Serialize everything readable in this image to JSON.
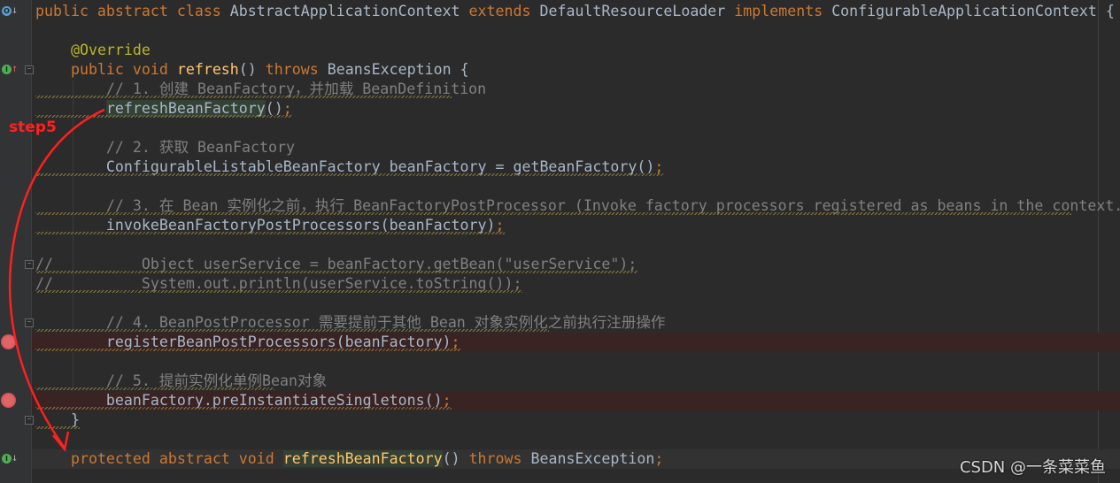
{
  "editor": {
    "language": "java",
    "colors": {
      "background": "#2b2b2b",
      "keyword": "#cc7832",
      "annotation": "#bbb529",
      "method": "#ffc66d",
      "text": "#a9b7c6",
      "comment": "#808080",
      "breakpoint": "#e06666",
      "annotation_arrow": "#ff2020"
    },
    "lines": [
      {
        "tokens": [
          [
            "kw",
            "public abstract class "
          ],
          [
            "id",
            "AbstractApplicationContext "
          ],
          [
            "kw",
            "extends "
          ],
          [
            "id",
            "DefaultResourceLoader "
          ],
          [
            "kw",
            "implements "
          ],
          [
            "id",
            "ConfigurableApplicationContext {"
          ]
        ]
      },
      {
        "tokens": []
      },
      {
        "tokens": [
          [
            "id",
            "    "
          ],
          [
            "ann",
            "@Override"
          ]
        ]
      },
      {
        "tokens": [
          [
            "id",
            "    "
          ],
          [
            "kw",
            "public void "
          ],
          [
            "fn",
            "refresh"
          ],
          [
            "id",
            "() "
          ],
          [
            "kw",
            "throws "
          ],
          [
            "id",
            "BeansException {"
          ]
        ]
      },
      {
        "tokens": [
          [
            "cm",
            "        // 1. 创建 BeanFactory，并加载 BeanDefinition"
          ]
        ],
        "squiggle": true
      },
      {
        "tokens": [
          [
            "id",
            "        "
          ],
          [
            "hl2",
            "refreshBeanFactory"
          ],
          [
            "id",
            "()"
          ],
          [
            "semi",
            ";"
          ]
        ],
        "squiggle": true
      },
      {
        "tokens": []
      },
      {
        "tokens": [
          [
            "cm",
            "        // 2. 获取 BeanFactory"
          ]
        ]
      },
      {
        "tokens": [
          [
            "id",
            "        ConfigurableListableBeanFactory beanFactory = getBeanFactory()"
          ],
          [
            "semi",
            ";"
          ]
        ],
        "squiggle": true
      },
      {
        "tokens": []
      },
      {
        "tokens": [
          [
            "cm",
            "        // 3. 在 Bean 实例化之前，执行 BeanFactoryPostProcessor (Invoke factory processors registered as beans in the context."
          ]
        ],
        "squiggle": true
      },
      {
        "tokens": [
          [
            "id",
            "        invokeBeanFactoryPostProcessors(beanFactory)"
          ],
          [
            "semi",
            ";"
          ]
        ],
        "squiggle": true
      },
      {
        "tokens": []
      },
      {
        "tokens": [
          [
            "cm",
            "//          Object userService = beanFactory.getBean(\"userService\");"
          ]
        ],
        "squiggle": true
      },
      {
        "tokens": [
          [
            "cm",
            "//          System.out.println(userService.toString());"
          ]
        ],
        "squiggle": true
      },
      {
        "tokens": []
      },
      {
        "tokens": [
          [
            "cm",
            "        // 4. BeanPostProcessor 需要提前于其他 Bean 对象实例化之前执行注册操作"
          ]
        ],
        "squiggle": true
      },
      {
        "tokens": [
          [
            "id",
            "        registerBeanPostProcessors(beanFactory)"
          ],
          [
            "semi",
            ";"
          ]
        ],
        "squiggle": true,
        "breakpoint": true
      },
      {
        "tokens": []
      },
      {
        "tokens": [
          [
            "cm",
            "        // 5. 提前实例化单例Bean对象"
          ]
        ],
        "squiggle": true
      },
      {
        "tokens": [
          [
            "id",
            "        beanFactory.preInstantiateSingletons()"
          ],
          [
            "semi",
            ";"
          ]
        ],
        "squiggle": true,
        "breakpoint": true
      },
      {
        "tokens": [
          [
            "id",
            "    }"
          ]
        ],
        "squiggle": true
      },
      {
        "tokens": []
      },
      {
        "tokens": [
          [
            "id",
            "    "
          ],
          [
            "kw",
            "protected abstract void "
          ],
          [
            "hl",
            "refreshBeanFactory"
          ],
          [
            "id",
            "() "
          ],
          [
            "kw",
            "throws "
          ],
          [
            "id",
            "BeansException"
          ],
          [
            "semi",
            ";"
          ]
        ],
        "current": true
      }
    ]
  },
  "gutter_icons": [
    {
      "line": 0,
      "icon": "overrides-icon",
      "glyph": "O"
    },
    {
      "line": 3,
      "icon": "implements-up-icon",
      "glyph": "I"
    },
    {
      "line": 23,
      "icon": "implemented-down-icon",
      "glyph": "I"
    }
  ],
  "annotation": {
    "label": "step5"
  },
  "watermark": "CSDN @一条菜菜鱼"
}
